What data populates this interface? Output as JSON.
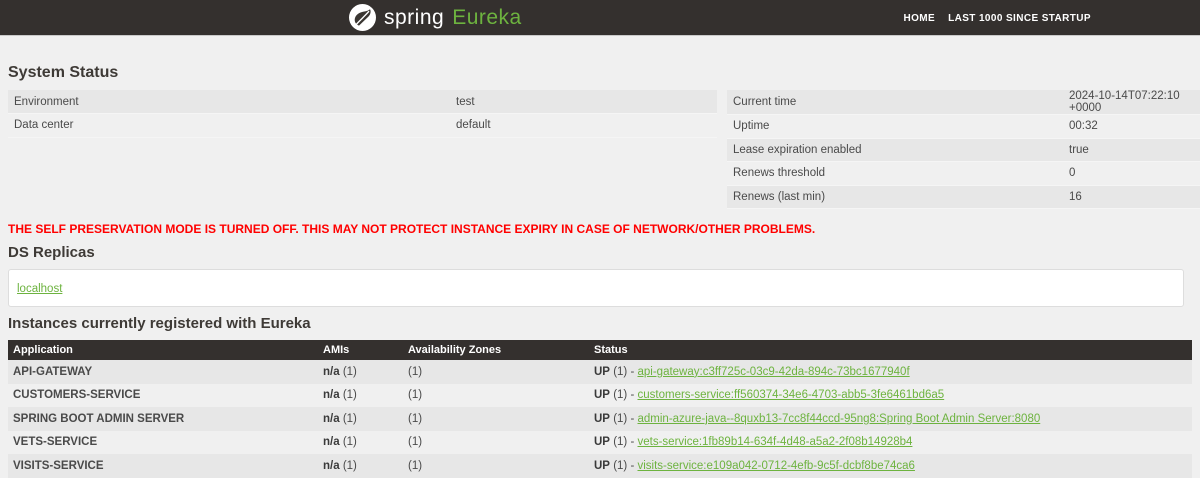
{
  "header": {
    "brand_spring": "spring",
    "brand_eureka": "Eureka",
    "nav": [
      {
        "label": "HOME"
      },
      {
        "label": "LAST 1000 SINCE STARTUP"
      }
    ]
  },
  "system_status": {
    "title": "System Status",
    "left_rows": [
      {
        "label": "Environment",
        "value": "test"
      },
      {
        "label": "Data center",
        "value": "default"
      }
    ],
    "right_rows": [
      {
        "label": "Current time",
        "value": "2024-10-14T07:22:10 +0000"
      },
      {
        "label": "Uptime",
        "value": "00:32"
      },
      {
        "label": "Lease expiration enabled",
        "value": "true"
      },
      {
        "label": "Renews threshold",
        "value": "0"
      },
      {
        "label": "Renews (last min)",
        "value": "16"
      }
    ]
  },
  "warning": "THE SELF PRESERVATION MODE IS TURNED OFF. THIS MAY NOT PROTECT INSTANCE EXPIRY IN CASE OF NETWORK/OTHER PROBLEMS.",
  "ds_replicas": {
    "title": "DS Replicas",
    "replicas": [
      {
        "label": "localhost"
      }
    ]
  },
  "instances": {
    "title": "Instances currently registered with Eureka",
    "columns": [
      "Application",
      "AMIs",
      "Availability Zones",
      "Status"
    ],
    "separator": "-",
    "rows": [
      {
        "application": "API-GATEWAY",
        "amis": "n/a",
        "amis_count": "(1)",
        "zones": "(1)",
        "status": "UP",
        "status_count": "(1)",
        "instance_link": "api-gateway:c3ff725c-03c9-42da-894c-73bc1677940f"
      },
      {
        "application": "CUSTOMERS-SERVICE",
        "amis": "n/a",
        "amis_count": "(1)",
        "zones": "(1)",
        "status": "UP",
        "status_count": "(1)",
        "instance_link": "customers-service:ff560374-34e6-4703-abb5-3fe6461bd6a5"
      },
      {
        "application": "SPRING BOOT ADMIN SERVER",
        "amis": "n/a",
        "amis_count": "(1)",
        "zones": "(1)",
        "status": "UP",
        "status_count": "(1)",
        "instance_link": "admin-azure-java--8quxb13-7cc8f44ccd-95ng8:Spring Boot Admin Server:8080"
      },
      {
        "application": "VETS-SERVICE",
        "amis": "n/a",
        "amis_count": "(1)",
        "zones": "(1)",
        "status": "UP",
        "status_count": "(1)",
        "instance_link": "vets-service:1fb89b14-634f-4d48-a5a2-2f08b14928b4"
      },
      {
        "application": "VISITS-SERVICE",
        "amis": "n/a",
        "amis_count": "(1)",
        "zones": "(1)",
        "status": "UP",
        "status_count": "(1)",
        "instance_link": "visits-service:e109a042-0712-4efb-9c5f-dcbf8be74ca6"
      }
    ]
  },
  "colors": {
    "topbar_bg": "#34302e",
    "accent_green": "#6db33f",
    "stripe_gray": "#e7e7e7",
    "page_bg": "#f0f0f0",
    "warning_red": "#ff0000"
  }
}
